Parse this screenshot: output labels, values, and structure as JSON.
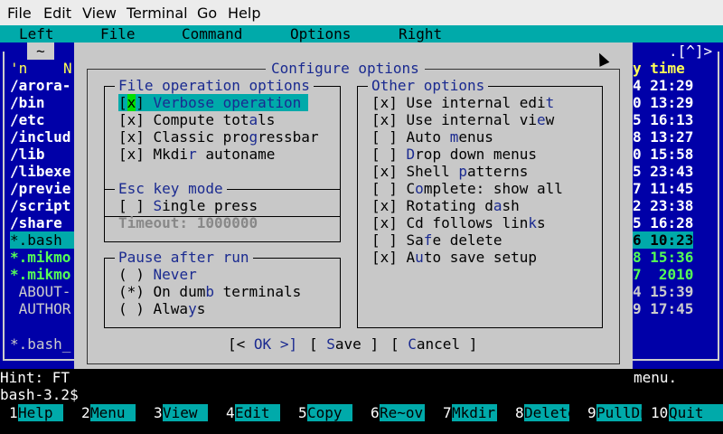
{
  "menubar": {
    "file": "File",
    "edit": "Edit",
    "view": "View",
    "terminal": "Terminal",
    "go": "Go",
    "help": "Help"
  },
  "mc_menu": {
    "left": "Left",
    "file": "File",
    "command": "Command",
    "options": "Options",
    "right": "Right"
  },
  "left_panel": {
    "tab": "~",
    "header_n": "'n",
    "header_name": "N",
    "files": [
      "/arora-",
      "/bin",
      "/etc",
      "/includ",
      "/lib",
      "/libexe",
      "/previe",
      "/script",
      "/share",
      "*.bash",
      "*.mikmo",
      "*.mikmo",
      " ABOUT-",
      " AUTHOR"
    ],
    "status": "*.bash_"
  },
  "right_panel": {
    "arrows": ".[^]>",
    "header_time": "y time",
    "times": [
      "4 21:29",
      "0 13:29",
      "5 16:13",
      "8 13:27",
      "0 15:58",
      "5 23:43",
      "7 11:45",
      "2 23:38",
      "5 16:28",
      "6 10:23",
      "8 15:36",
      "7  2010",
      "4 15:39",
      "9 17:45"
    ]
  },
  "dialog": {
    "title": "Configure options",
    "file_ops": {
      "title": "File operation options",
      "verbose": {
        "pre": "[",
        "mark": "x",
        "post": "] ",
        "hk": "V",
        "rest": "erbose operation"
      },
      "compute": {
        "text": "[x] Compute tot",
        "hk": "a",
        "rest": "ls"
      },
      "classic": {
        "text": "[x] Classic pro",
        "hk": "g",
        "rest": "ressbar"
      },
      "mkdir": {
        "text": "[x] Mkdi",
        "hk": "r",
        "rest": " autoname"
      }
    },
    "esc": {
      "title": "Esc key mode",
      "single": {
        "text": "[ ] ",
        "hk": "S",
        "rest": "ingle press"
      },
      "timeout": "Timeout: 1000000"
    },
    "pause": {
      "title": "Pause after run",
      "never": {
        "text": "( ) ",
        "hk": "N",
        "rest": "ever"
      },
      "dumb": {
        "text": "(*) On dum",
        "hk": "b",
        "rest": " terminals"
      },
      "always": {
        "text": "( ) Alwa",
        "hk": "y",
        "rest": "s"
      }
    },
    "other": {
      "title": "Other options",
      "items": [
        {
          "text": "[x] Use internal edi",
          "hk": "t",
          "rest": ""
        },
        {
          "text": "[x] Use internal vi",
          "hk": "e",
          "rest": "w"
        },
        {
          "text": "[ ] Auto ",
          "hk": "m",
          "rest": "enus"
        },
        {
          "text": "[ ] ",
          "hk": "D",
          "rest": "rop down menus"
        },
        {
          "text": "[x] Shell ",
          "hk": "p",
          "rest": "atterns"
        },
        {
          "text": "[ ] C",
          "hk": "o",
          "rest": "mplete: show all"
        },
        {
          "text": "[x] Rotating d",
          "hk": "a",
          "rest": "sh"
        },
        {
          "text": "[x] Cd follows lin",
          "hk": "k",
          "rest": "s"
        },
        {
          "text": "[ ] Sa",
          "hk": "f",
          "rest": "e delete"
        },
        {
          "text": "[x] A",
          "hk": "u",
          "rest": "to save setup"
        }
      ]
    },
    "buttons": {
      "ok": {
        "pre": "[< ",
        "hk": "O",
        "rest": "K >]"
      },
      "save": {
        "pre": "[ ",
        "hk": "S",
        "rest": "ave ]"
      },
      "cancel": {
        "pre": "[ ",
        "hk": "C",
        "rest": "ancel ]"
      }
    }
  },
  "hint": {
    "left": "Hint: FT",
    "right": "menu.",
    "prompt": "bash-3.2$ "
  },
  "fkeys": [
    {
      "n": "1",
      "label": "Help"
    },
    {
      "n": "2",
      "label": "Menu"
    },
    {
      "n": "3",
      "label": "View"
    },
    {
      "n": "4",
      "label": "Edit"
    },
    {
      "n": "5",
      "label": "Copy"
    },
    {
      "n": "6",
      "label": "Re~ov"
    },
    {
      "n": "7",
      "label": "Mkdir"
    },
    {
      "n": "8",
      "label": "Delete"
    },
    {
      "n": "9",
      "label": "PullDn"
    },
    {
      "n": "10",
      "label": "Quit"
    }
  ],
  "colors": {
    "panel": "#0000a8",
    "cyan": "#00aaaa",
    "dialog": "#c8c8c8",
    "hotkey": "#1a2a90",
    "cursor": "#00e000"
  }
}
